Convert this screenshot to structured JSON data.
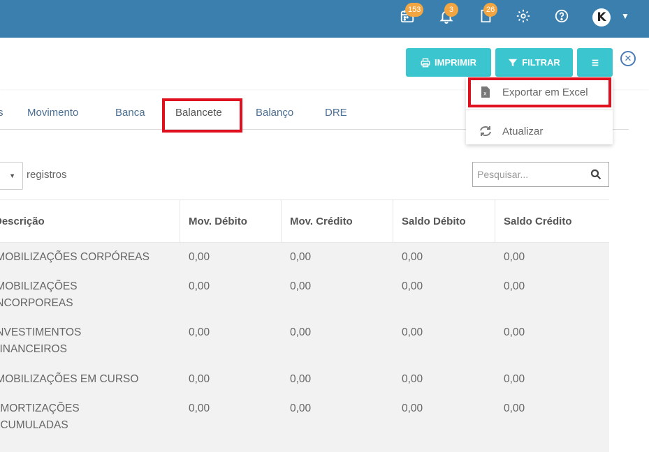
{
  "header": {
    "badges": {
      "calendar": "153",
      "bell": "3",
      "document": "26"
    },
    "icons": [
      "calendar-icon",
      "bell-icon",
      "document-icon",
      "gear-icon",
      "help-icon"
    ],
    "avatar_letter": "K",
    "colors": {
      "bar": "#3a7fad",
      "badge": "#f2a541"
    }
  },
  "toolbar": {
    "print_label": "IMPRIMIR",
    "filter_label": "FILTRAR",
    "menu_icon": "hamburger-icon",
    "close_icon": "close-circle-icon",
    "accent": "#3bc5ce"
  },
  "dropdown": {
    "items": [
      {
        "label": "Exportar em Excel",
        "icon": "excel-file-icon"
      },
      {
        "label": "Atualizar",
        "icon": "refresh-icon"
      }
    ],
    "highlight_color": "#e0101e"
  },
  "tabs": [
    {
      "label": "s"
    },
    {
      "label": "Movimento"
    },
    {
      "label": "Banca"
    },
    {
      "label": "Balancete",
      "active": true
    },
    {
      "label": "Balanço"
    },
    {
      "label": "DRE"
    }
  ],
  "controls": {
    "registros_label": "registros",
    "search_placeholder": "Pesquisar..."
  },
  "table": {
    "columns": [
      "Descrição",
      "Mov. Débito",
      "Mov. Crédito",
      "Saldo Débito",
      "Saldo Crédito"
    ],
    "rows": [
      {
        "desc": [
          "IMOBILIZAÇÕES CORPÓREAS"
        ],
        "mov_debito": "0,00",
        "mov_credito": "0,00",
        "saldo_debito": "0,00",
        "saldo_credito": "0,00"
      },
      {
        "desc": [
          "IMOBILIZAÇÕES",
          "INCORPOREAS"
        ],
        "mov_debito": "0,00",
        "mov_credito": "0,00",
        "saldo_debito": "0,00",
        "saldo_credito": "0,00"
      },
      {
        "desc": [
          "INVESTIMENTOS",
          "FINANCEIROS"
        ],
        "mov_debito": "0,00",
        "mov_credito": "0,00",
        "saldo_debito": "0,00",
        "saldo_credito": "0,00"
      },
      {
        "desc": [
          "IMOBILIZAÇÕES EM CURSO"
        ],
        "mov_debito": "0,00",
        "mov_credito": "0,00",
        "saldo_debito": "0,00",
        "saldo_credito": "0,00"
      },
      {
        "desc": [
          "AMORTIZAÇÕES",
          "ACUMULADAS"
        ],
        "mov_debito": "0,00",
        "mov_credito": "0,00",
        "saldo_debito": "0,00",
        "saldo_credito": "0,00"
      }
    ]
  }
}
